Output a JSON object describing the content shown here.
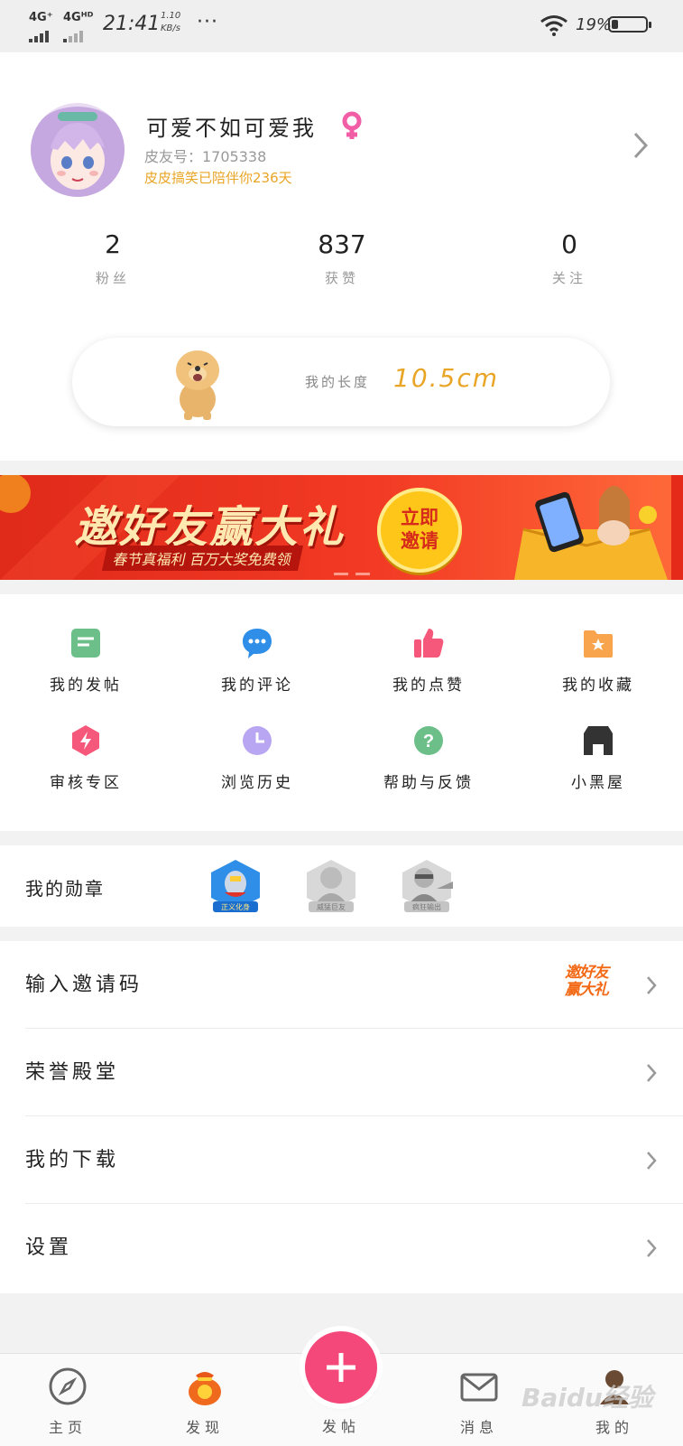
{
  "status_bar": {
    "network_1": "4G⁺",
    "network_2": "4Gᴴᴰ",
    "time": "21:41",
    "speed_value": "1.10",
    "speed_unit": "KB/s",
    "more": "···",
    "battery_text": "19%",
    "battery_level": 0.19
  },
  "profile": {
    "nickname": "可爱不如可爱我",
    "gender_icon": "female-icon",
    "pipi_id": "皮友号：1705338",
    "days_text": "皮皮搞笑已陪伴你236天",
    "stats": [
      {
        "value": "2",
        "label": "粉丝"
      },
      {
        "value": "837",
        "label": "获赞"
      },
      {
        "value": "0",
        "label": "关注"
      }
    ],
    "length_label": "我的长度",
    "length_value": "10.5cm"
  },
  "banner": {
    "title": "邀好友赢大礼",
    "subtitle": "春节真福利 百万大奖免费领",
    "button_line1": "立即",
    "button_line2": "邀请"
  },
  "grid": [
    {
      "label": "我的发帖",
      "icon": "post-icon",
      "color": "#6dbf8a"
    },
    {
      "label": "我的评论",
      "icon": "comment-icon",
      "color": "#2f8fe8"
    },
    {
      "label": "我的点赞",
      "icon": "thumbs-up-icon",
      "color": "#f5587a"
    },
    {
      "label": "我的收藏",
      "icon": "favorite-folder-icon",
      "color": "#f8a44c"
    },
    {
      "label": "审核专区",
      "icon": "review-icon",
      "color": "#f5587a"
    },
    {
      "label": "浏览历史",
      "icon": "history-icon",
      "color": "#b9a6f2"
    },
    {
      "label": "帮助与反馈",
      "icon": "help-icon",
      "color": "#6dbf8a"
    },
    {
      "label": "小黑屋",
      "icon": "black-house-icon",
      "color": "#333333"
    }
  ],
  "medals": {
    "title": "我的勋章",
    "items": [
      {
        "label": "正义化身"
      },
      {
        "label": "威猛巨友"
      },
      {
        "label": "疯狂输出"
      }
    ]
  },
  "menu": [
    {
      "label": "输入邀请码",
      "promo_line1": "邀好友",
      "promo_line2": "赢大礼"
    },
    {
      "label": "荣誉殿堂"
    },
    {
      "label": "我的下载"
    },
    {
      "label": "设置"
    }
  ],
  "tabbar": {
    "home": "主页",
    "discover": "发现",
    "post": "发帖",
    "messages": "消息",
    "me": "我的",
    "accent": "#f4487a"
  },
  "watermark": "Baidu经验"
}
